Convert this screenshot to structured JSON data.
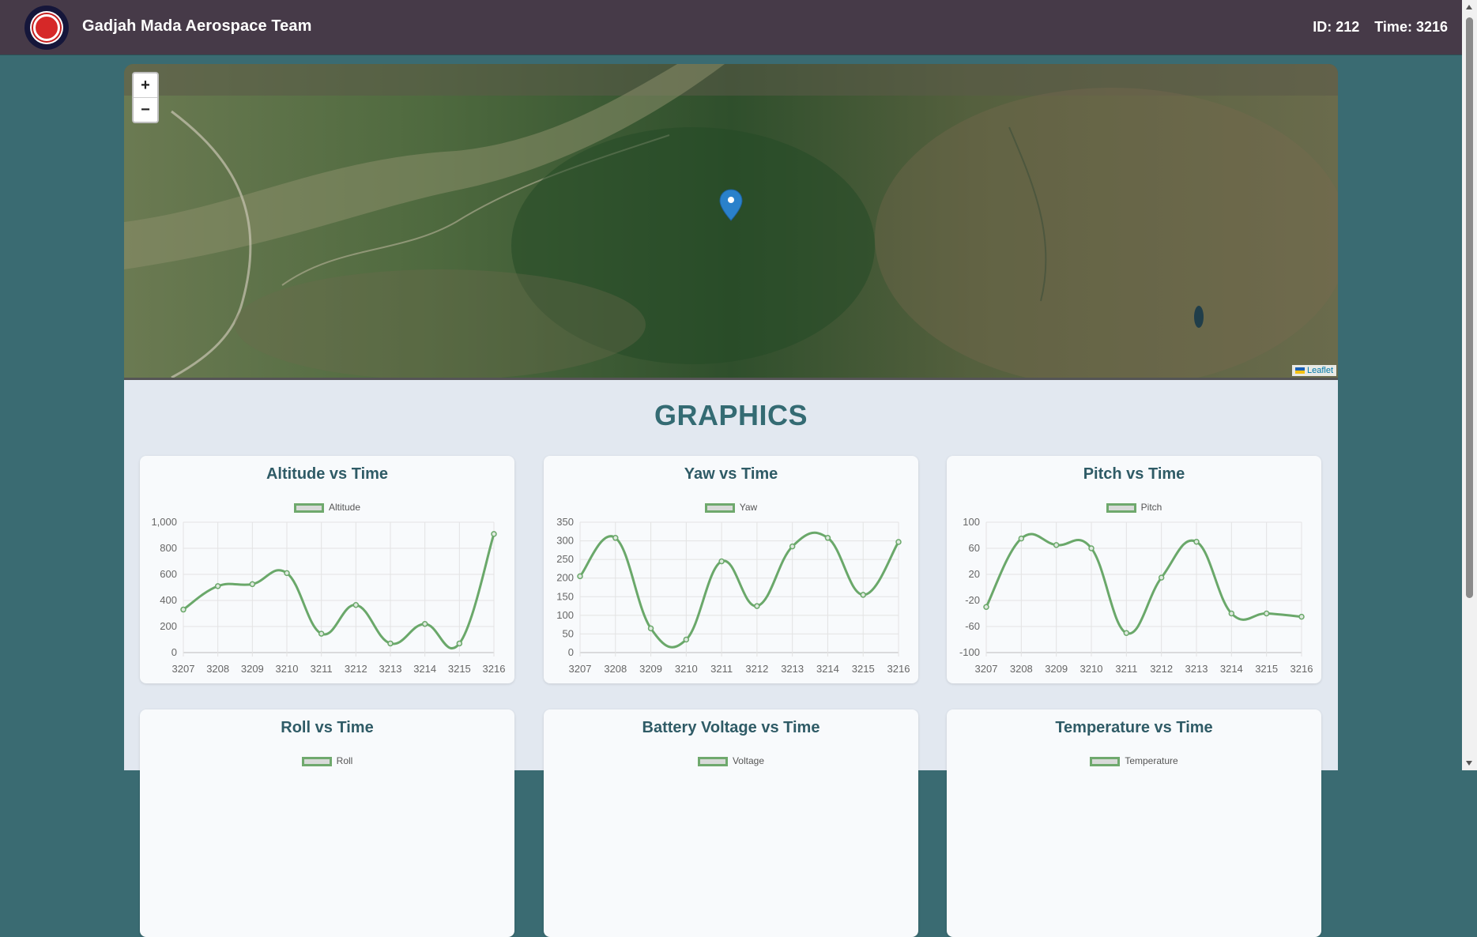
{
  "header": {
    "title": "Gadjah Mada Aerospace Team",
    "id_label": "ID: 212",
    "time_label": "Time: 3216"
  },
  "map": {
    "zoom_in": "+",
    "zoom_out": "−",
    "attribution": "Leaflet"
  },
  "section_title": "GRAPHICS",
  "charts": [
    {
      "title": "Altitude vs Time",
      "legend": "Altitude",
      "yticks": [
        "1,000",
        "800",
        "600",
        "400",
        "200",
        "0"
      ],
      "xticks": [
        "3207",
        "3208",
        "3209",
        "3210",
        "3211",
        "3212",
        "3213",
        "3214",
        "3215",
        "3216"
      ]
    },
    {
      "title": "Yaw vs Time",
      "legend": "Yaw",
      "yticks": [
        "350",
        "300",
        "250",
        "200",
        "150",
        "100",
        "50",
        "0"
      ],
      "xticks": [
        "3207",
        "3208",
        "3209",
        "3210",
        "3211",
        "3212",
        "3213",
        "3214",
        "3215",
        "3216"
      ]
    },
    {
      "title": "Pitch vs Time",
      "legend": "Pitch",
      "yticks": [
        "100",
        "60",
        "20",
        "-20",
        "-60",
        "-100"
      ],
      "xticks": [
        "3207",
        "3208",
        "3209",
        "3210",
        "3211",
        "3212",
        "3213",
        "3214",
        "3215",
        "3216"
      ]
    },
    {
      "title": "Roll vs Time",
      "legend": "Roll"
    },
    {
      "title": "Battery Voltage vs Time",
      "legend": "Voltage"
    },
    {
      "title": "Temperature vs Time",
      "legend": "Temperature"
    }
  ],
  "chart_data": [
    {
      "type": "line",
      "title": "Altitude vs Time",
      "x": [
        3207,
        3208,
        3209,
        3210,
        3211,
        3212,
        3213,
        3214,
        3215,
        3216
      ],
      "series": [
        {
          "name": "Altitude",
          "values": [
            330,
            510,
            525,
            610,
            145,
            365,
            70,
            220,
            70,
            910
          ]
        }
      ],
      "ylim": [
        0,
        1000
      ],
      "color": "#6aa86a"
    },
    {
      "type": "line",
      "title": "Yaw vs Time",
      "x": [
        3207,
        3208,
        3209,
        3210,
        3211,
        3212,
        3213,
        3214,
        3215,
        3216
      ],
      "series": [
        {
          "name": "Yaw",
          "values": [
            205,
            308,
            65,
            35,
            245,
            125,
            285,
            308,
            155,
            297
          ]
        }
      ],
      "ylim": [
        0,
        350
      ],
      "color": "#6aa86a"
    },
    {
      "type": "line",
      "title": "Pitch vs Time",
      "x": [
        3207,
        3208,
        3209,
        3210,
        3211,
        3212,
        3213,
        3214,
        3215,
        3216
      ],
      "series": [
        {
          "name": "Pitch",
          "values": [
            -30,
            75,
            65,
            60,
            -70,
            15,
            70,
            -40,
            -40,
            -45
          ]
        }
      ],
      "ylim": [
        -100,
        100
      ],
      "color": "#6aa86a"
    }
  ]
}
